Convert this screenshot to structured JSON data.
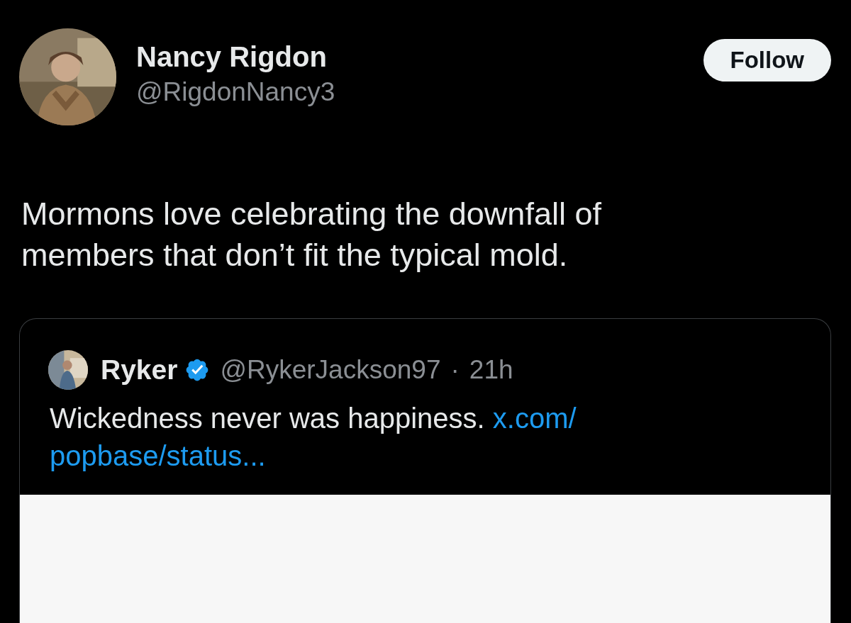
{
  "author": {
    "name": "Nancy Rigdon",
    "handle": "@RigdonNancy3"
  },
  "follow_button": {
    "label": "Follow"
  },
  "tweet_text": "Mormons love celebrating the downfall of members that don’t fit the typical mold.",
  "quote": {
    "name": "Ryker",
    "verified": true,
    "handle": "@RykerJackson97",
    "separator": "·",
    "time": "21h",
    "text": "Wickedness never was happiness.",
    "link_lines": [
      "x.com/",
      "popbase/status..."
    ],
    "media": {
      "kind": "blank"
    }
  }
}
